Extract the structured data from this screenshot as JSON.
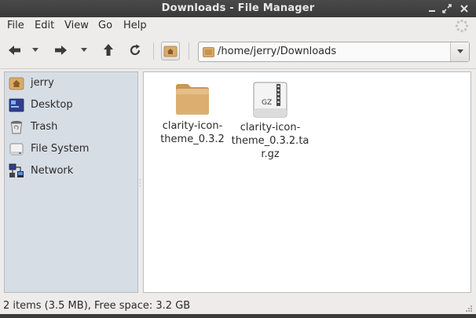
{
  "window": {
    "title": "Downloads - File Manager"
  },
  "menubar": {
    "items": [
      "File",
      "Edit",
      "View",
      "Go",
      "Help"
    ]
  },
  "location": {
    "path": "/home/jerry/Downloads"
  },
  "sidebar": {
    "items": [
      {
        "label": "jerry",
        "icon": "home-folder-icon"
      },
      {
        "label": "Desktop",
        "icon": "desktop-icon"
      },
      {
        "label": "Trash",
        "icon": "trash-icon"
      },
      {
        "label": "File System",
        "icon": "drive-icon"
      },
      {
        "label": "Network",
        "icon": "network-icon"
      }
    ]
  },
  "files": [
    {
      "name": "clarity-icon-theme_0.3.2",
      "icon": "folder-icon"
    },
    {
      "name": "clarity-icon-theme_0.3.2.tar.gz",
      "icon": "gz-archive-icon",
      "badge": "GZ"
    }
  ],
  "status": {
    "text": "2 items (3.5 MB), Free space: 3.2 GB"
  },
  "colors": {
    "sidebar_bg": "#d7dde4",
    "titlebar_bg": "#3e3e3e",
    "folder": "#d9ab6b"
  }
}
